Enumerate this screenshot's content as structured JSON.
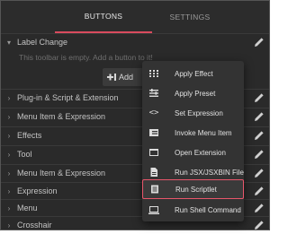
{
  "tabs": [
    {
      "label": "BUTTONS",
      "active": true
    },
    {
      "label": "SETTINGS",
      "active": false
    }
  ],
  "list": {
    "expanded_group": {
      "label": "Label Change",
      "empty_message": "This toolbar is empty. Add a button to it!",
      "add_button_label": "Add"
    },
    "groups": [
      "Plug-in & Script & Extension",
      "Menu Item & Expression",
      "Effects",
      "Tool",
      "Menu Item & Expression",
      "Expression",
      "Menu",
      "Crosshair"
    ]
  },
  "menu": {
    "items": [
      {
        "label": "Apply Effect",
        "icon": "effect-icon"
      },
      {
        "label": "Apply Preset",
        "icon": "preset-icon"
      },
      {
        "label": "Set Expression",
        "icon": "code-icon"
      },
      {
        "label": "Invoke Menu Item",
        "icon": "menu-item-icon"
      },
      {
        "label": "Open Extension",
        "icon": "extension-icon"
      },
      {
        "label": "Run JSX/JSXBIN File",
        "icon": "file-icon"
      },
      {
        "label": "Run Scriptlet",
        "icon": "scriptlet-icon",
        "highlighted": true
      },
      {
        "label": "Run Shell Command",
        "icon": "terminal-icon"
      }
    ]
  },
  "colors": {
    "accent": "#d94b5e",
    "highlight_border": "#e8566b",
    "background": "#2a2a2a",
    "menu_background": "#333333"
  }
}
